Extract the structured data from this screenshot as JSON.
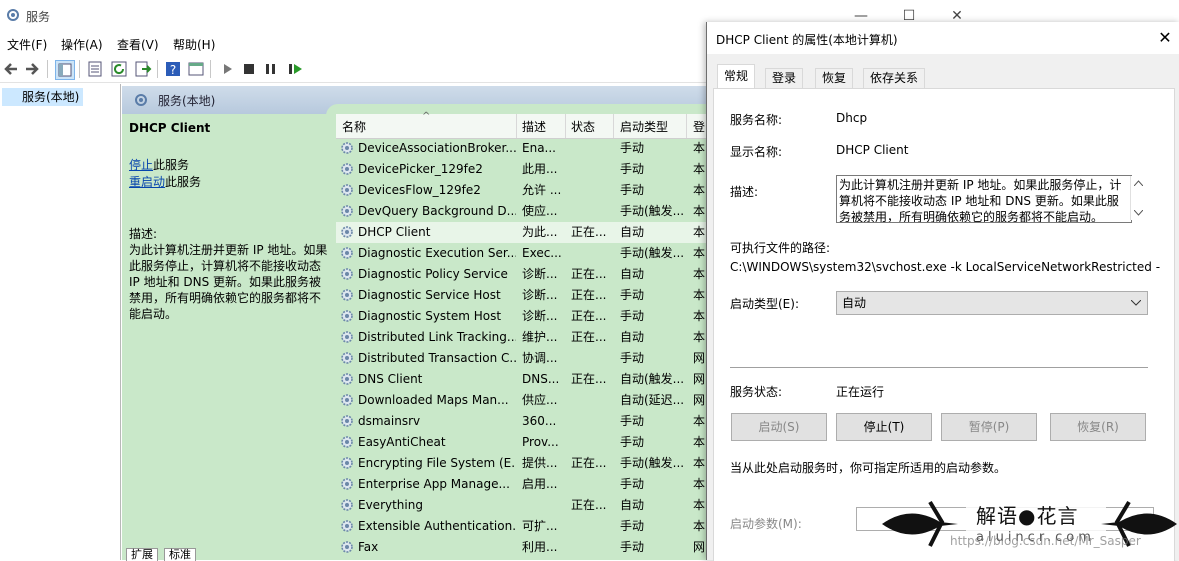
{
  "window": {
    "title": "服务",
    "controls": {
      "minimize": "—",
      "maximize": "☐",
      "close": "✕"
    }
  },
  "menubar": [
    "文件(F)",
    "操作(A)",
    "查看(V)",
    "帮助(H)"
  ],
  "tree": {
    "item": "服务(本地)"
  },
  "content": {
    "header": "服务(本地)",
    "selected_service": "DHCP Client",
    "action_stop": "停止",
    "action_stop_suffix": "此服务",
    "action_restart": "重启动",
    "action_restart_suffix": "此服务",
    "desc_label": "描述:",
    "desc_text": "为此计算机注册并更新 IP 地址。如果此服务停止，计算机将不能接收动态 IP 地址和 DNS 更新。如果此服务被禁用，所有明确依赖它的服务都将不能启动。"
  },
  "list": {
    "columns": [
      "名称",
      "描述",
      "状态",
      "启动类型",
      "登"
    ],
    "rows": [
      [
        "DeviceAssociationBroker...",
        "Ena...",
        "",
        "手动",
        "本"
      ],
      [
        "DevicePicker_129fe2",
        "此用...",
        "",
        "手动",
        "本"
      ],
      [
        "DevicesFlow_129fe2",
        "允许 ...",
        "",
        "手动",
        "本"
      ],
      [
        "DevQuery Background D...",
        "使应...",
        "",
        "手动(触发...",
        "本"
      ],
      [
        "DHCP Client",
        "为此...",
        "正在...",
        "自动",
        "本"
      ],
      [
        "Diagnostic Execution Ser...",
        "Exec...",
        "",
        "手动(触发...",
        "本"
      ],
      [
        "Diagnostic Policy Service",
        "诊断...",
        "正在...",
        "自动",
        "本"
      ],
      [
        "Diagnostic Service Host",
        "诊断...",
        "正在...",
        "手动",
        "本"
      ],
      [
        "Diagnostic System Host",
        "诊断...",
        "正在...",
        "手动",
        "本"
      ],
      [
        "Distributed Link Tracking...",
        "维护...",
        "正在...",
        "自动",
        "本"
      ],
      [
        "Distributed Transaction C...",
        "协调...",
        "",
        "手动",
        "网"
      ],
      [
        "DNS Client",
        "DNS...",
        "正在...",
        "自动(触发...",
        "网"
      ],
      [
        "Downloaded Maps Man...",
        "供应...",
        "",
        "自动(延迟...",
        "网"
      ],
      [
        "dsmainsrv",
        "360...",
        "",
        "手动",
        "本"
      ],
      [
        "EasyAntiCheat",
        "Prov...",
        "",
        "手动",
        "本"
      ],
      [
        "Encrypting File System (E...",
        "提供...",
        "正在...",
        "手动(触发...",
        "本"
      ],
      [
        "Enterprise App Manage...",
        "启用...",
        "",
        "手动",
        "本"
      ],
      [
        "Everything",
        "",
        "正在...",
        "自动",
        "本"
      ],
      [
        "Extensible Authentication...",
        "可扩...",
        "",
        "手动",
        "本"
      ],
      [
        "Fax",
        "利用...",
        "",
        "手动",
        "网"
      ]
    ],
    "selected_index": 4
  },
  "bottom_tabs": [
    "扩展",
    "标准"
  ],
  "dialog": {
    "title": "DHCP Client 的属性(本地计算机)",
    "close": "✕",
    "tabs": [
      "常规",
      "登录",
      "恢复",
      "依存关系"
    ],
    "active_tab": 0,
    "service_name_label": "服务名称:",
    "service_name": "Dhcp",
    "display_name_label": "显示名称:",
    "display_name": "DHCP Client",
    "desc_label": "描述:",
    "description": "为此计算机注册并更新 IP 地址。如果此服务停止，计算机将不能接收动态 IP 地址和 DNS 更新。如果此服务被禁用，所有明确依赖它的服务都将不能启动。",
    "path_label": "可执行文件的路径:",
    "path": "C:\\WINDOWS\\system32\\svchost.exe -k LocalServiceNetworkRestricted -",
    "startup_label": "启动类型(E):",
    "startup_value": "自动",
    "status_label": "服务状态:",
    "status_value": "正在运行",
    "buttons": {
      "start": "启动(S)",
      "stop": "停止(T)",
      "pause": "暂停(P)",
      "resume": "恢复(R)"
    },
    "hint": "当从此处启动服务时，你可指定所适用的启动参数。",
    "params_label": "启动参数(M):"
  },
  "watermark": {
    "title": "解语●花言",
    "sub": "aluincr.com",
    "url": "https://blog.csdn.net/Mr_Sasper"
  },
  "colors": {
    "list_bg": "#c9e8c9",
    "link": "#0645ad",
    "selection": "#cce8ff"
  }
}
